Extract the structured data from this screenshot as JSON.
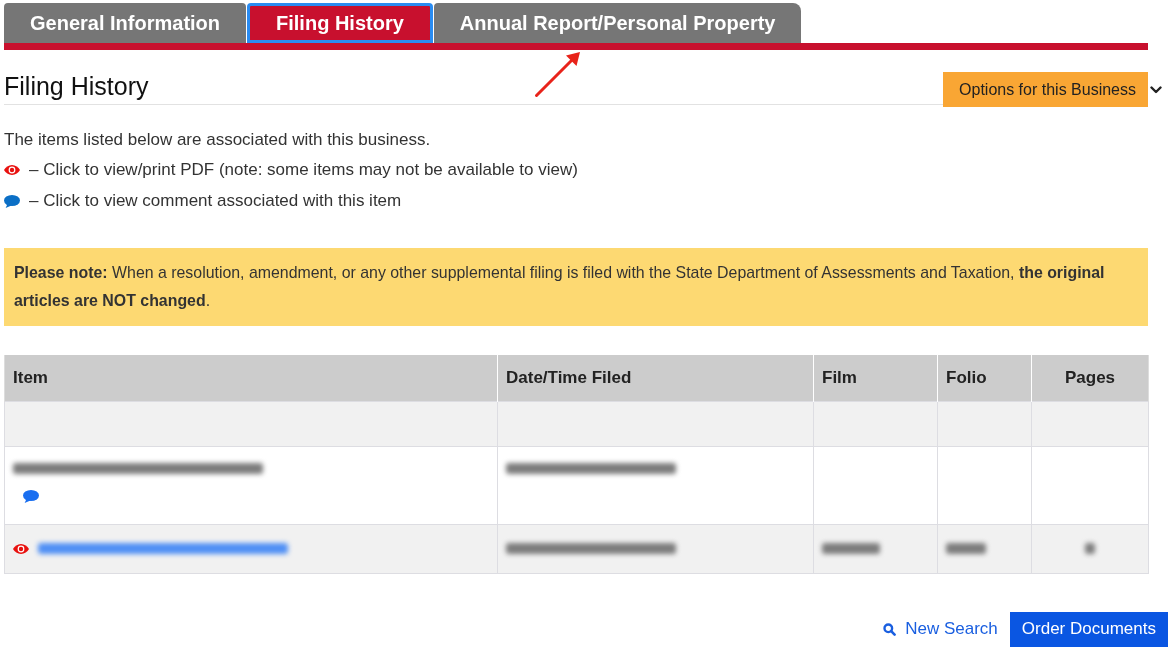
{
  "tabs": [
    {
      "label": "General Information",
      "selected": false,
      "focused": false
    },
    {
      "label": "Filing History",
      "selected": true,
      "focused": true
    },
    {
      "label": "Annual Report/Personal Property",
      "selected": false,
      "focused": false
    }
  ],
  "heading": "Filing History",
  "options_button": {
    "label": "Options for this Business"
  },
  "intro": "The items listed below are associated with this business.",
  "legend": [
    {
      "kind": "pdf",
      "text": "– Click to view/print PDF (note: some items may not be available to view)"
    },
    {
      "kind": "comment",
      "text": "– Click to view comment associated with this item"
    }
  ],
  "notice": "**Please note:** When a resolution, amendment, or any other supplemental filing is filed with the State Department of Assessments and Taxation, **the original articles are NOT changed**.",
  "table": {
    "columns": [
      "Item",
      "Date/Time Filed",
      "Film",
      "Folio",
      "Pages"
    ],
    "rows": [
      {
        "comment_icon": false,
        "pdf_icon": false,
        "redacted_cells": [
          false,
          false,
          false,
          false,
          false
        ]
      },
      {
        "comment_icon": true,
        "pdf_icon": false,
        "item_link": false,
        "redacted_cells": [
          true,
          true,
          false,
          false,
          false
        ]
      },
      {
        "comment_icon": false,
        "pdf_icon": true,
        "item_link": true,
        "redacted_cells": [
          true,
          true,
          true,
          true,
          true
        ]
      }
    ]
  },
  "actions": {
    "new_search": "New Search",
    "order_documents": "Order Documents"
  }
}
